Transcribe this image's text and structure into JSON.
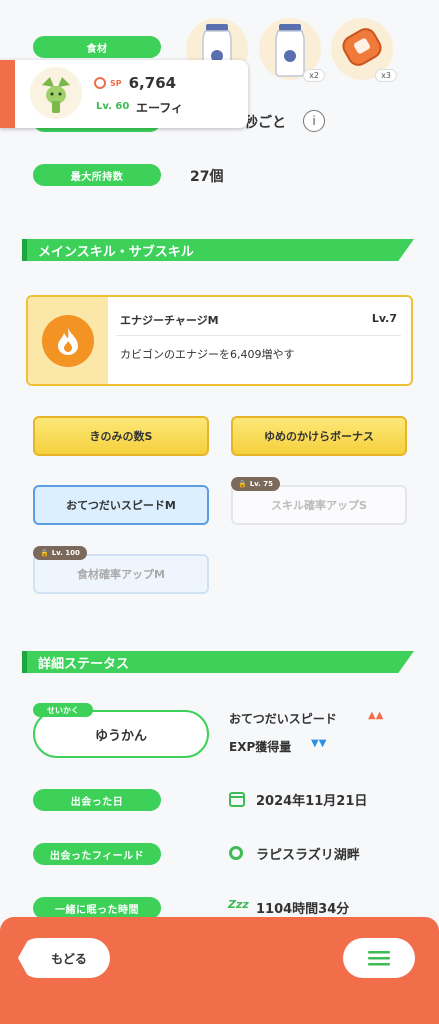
{
  "ingredients_label": "食材",
  "ingredients": [
    {
      "icon": "milk-bottle-icon",
      "qty": ""
    },
    {
      "icon": "milk-bottle-icon",
      "qty": "x2"
    },
    {
      "icon": "sausage-icon",
      "qty": "x3"
    }
  ],
  "pokemon_card": {
    "sp_label": "SP",
    "sp_value": "6,764",
    "level": "Lv. 60",
    "name": "エーフィ"
  },
  "help_interval_suffix": "秒ごと",
  "max_carry_label": "最大所持数",
  "max_carry_value": "27個",
  "skill_section": {
    "title": "メインスキル・サブスキル",
    "main_skill": {
      "name": "エナジーチャージM",
      "level": "Lv.7",
      "description": "カビゴンのエナジーを6,409増やす"
    },
    "sub_skills": [
      {
        "label": "きのみの数S",
        "style": "yellow"
      },
      {
        "label": "ゆめのかけらボーナス",
        "style": "yellow"
      },
      {
        "label": "おてつだいスピードM",
        "style": "blue"
      },
      {
        "label": "スキル確率アップS",
        "style": "locked",
        "lock": "Lv. 75"
      },
      {
        "label": "食材確率アップM",
        "style": "locked-blue",
        "lock": "Lv. 100"
      }
    ]
  },
  "detail_section": {
    "title": "詳細ステータス",
    "nature_tag": "せいかく",
    "nature": "ゆうかん",
    "nature_up": "おてつだいスピード",
    "nature_up_mark": "▲▲",
    "nature_down": "EXP獲得量",
    "nature_down_mark": "▼▼",
    "met_date_label": "出会った日",
    "met_date": "2024年11月21日",
    "met_field_label": "出会ったフィールド",
    "met_field": "ラピスラズリ湖畔",
    "sleep_time_label": "一緒に眠った時間",
    "sleep_time_icon": "Zzz",
    "sleep_time": "1104時間34分"
  },
  "bottom_bar": {
    "back_label": "もどる"
  },
  "colors": {
    "green": "#3dd15a",
    "orange": "#f26e4b",
    "yellow": "#f5d03e",
    "blue_up": "#f26e4b",
    "blue_down": "#2f8fe6"
  }
}
